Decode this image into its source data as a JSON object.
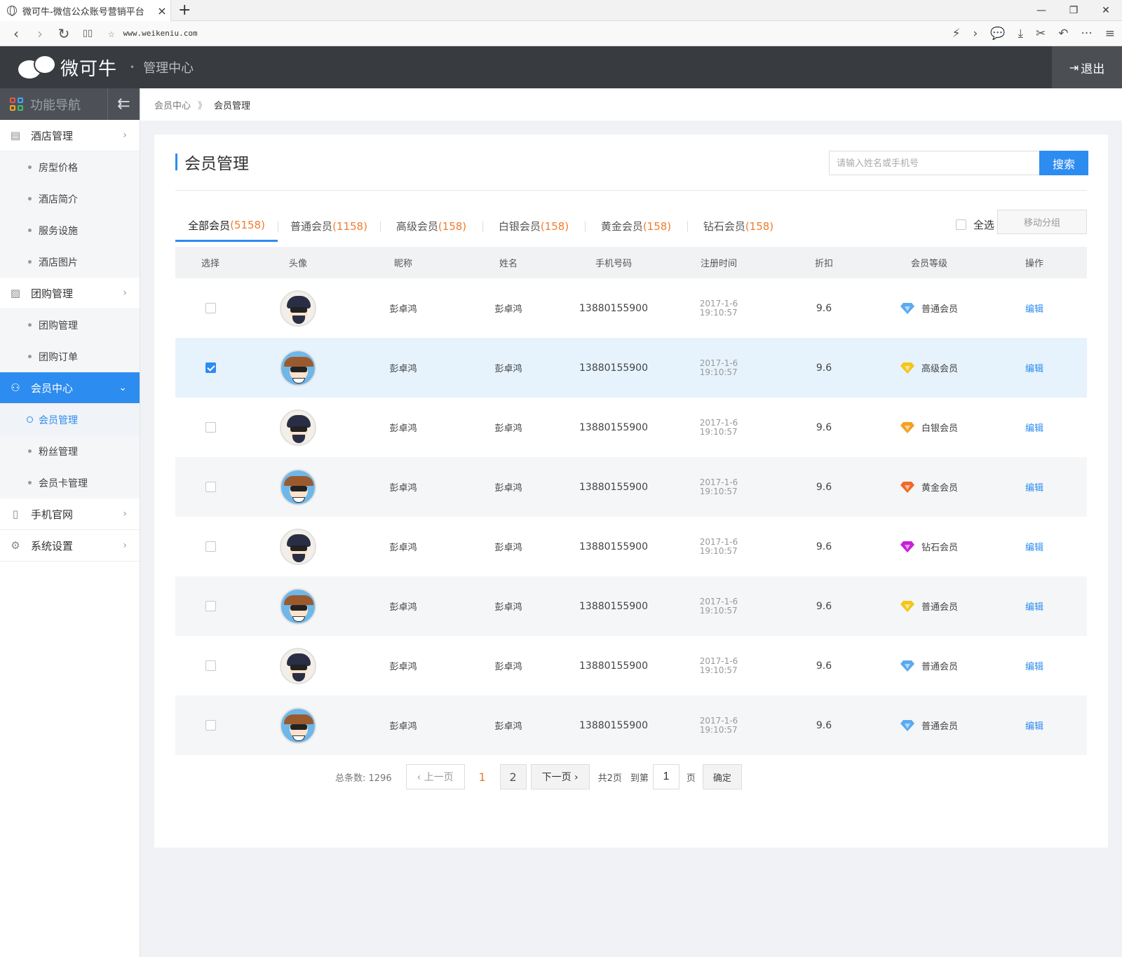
{
  "browser": {
    "tab_title": "微可牛-微信公众账号营销平台",
    "close": "×",
    "new_tab": "+",
    "url": "www.weikeniu.com",
    "win_min": "—",
    "win_max": "❐",
    "win_close": "✕",
    "nav_back": "‹",
    "nav_forward": "›",
    "nav_reload": "↻",
    "reader": "▯▯",
    "star": "☆",
    "tools": [
      "⚡",
      "›",
      "💬",
      "⤓",
      "✂",
      "↶",
      "···",
      "≡"
    ]
  },
  "header": {
    "brand": "微可牛",
    "dot": "•",
    "subtitle": "管理中心",
    "logout_icon": "⇥",
    "logout": "退出"
  },
  "sidebar": {
    "title": "功能导航",
    "collapse_icon": "⇇",
    "groups": [
      {
        "label": "酒店管理",
        "icon": "▤",
        "arrow": "›"
      },
      {
        "label": "团购管理",
        "icon": "▨",
        "arrow": "›"
      },
      {
        "label": "会员中心",
        "icon": "⚇",
        "arrow": "⌄"
      },
      {
        "label": "手机官网",
        "icon": "▯",
        "arrow": "›"
      },
      {
        "label": "系统设置",
        "icon": "⚙",
        "arrow": "›"
      }
    ],
    "hotel_items": [
      "房型价格",
      "酒店简介",
      "服务设施",
      "酒店图片"
    ],
    "group_items": [
      "团购管理",
      "团购订单"
    ],
    "member_items": [
      "会员管理",
      "粉丝管理",
      "会员卡管理"
    ]
  },
  "breadcrumb": {
    "parent": "会员中心",
    "sep": "》",
    "current": "会员管理"
  },
  "page": {
    "title": "会员管理",
    "search_placeholder": "请输入姓名或手机号",
    "search_button": "搜索",
    "select_all": "全选",
    "move_group": "移动分组"
  },
  "tabs": [
    {
      "label": "全部会员",
      "count": "(5158)"
    },
    {
      "label": "普通会员",
      "count": "(1158)"
    },
    {
      "label": "高级会员",
      "count": "(158)"
    },
    {
      "label": "白银会员",
      "count": "(158)"
    },
    {
      "label": "黄金会员",
      "count": "(158)"
    },
    {
      "label": "钻石会员",
      "count": "(158)"
    }
  ],
  "table": {
    "headers": [
      "选择",
      "头像",
      "昵称",
      "姓名",
      "手机号码",
      "注册时间",
      "折扣",
      "会员等级",
      "操作"
    ],
    "rows": [
      {
        "nickname": "彭卓鸿",
        "name": "彭卓鸿",
        "phone": "13880155900",
        "date": "2017-1-6",
        "time": "19:10:57",
        "discount": "9.6",
        "level": "普通会员",
        "level_color": "#5aaaf0",
        "action": "编辑"
      },
      {
        "nickname": "彭卓鸿",
        "name": "彭卓鸿",
        "phone": "13880155900",
        "date": "2017-1-6",
        "time": "19:10:57",
        "discount": "9.6",
        "level": "高级会员",
        "level_color": "#f5c518",
        "action": "编辑"
      },
      {
        "nickname": "彭卓鸿",
        "name": "彭卓鸿",
        "phone": "13880155900",
        "date": "2017-1-6",
        "time": "19:10:57",
        "discount": "9.6",
        "level": "白银会员",
        "level_color": "#f5a024",
        "action": "编辑"
      },
      {
        "nickname": "彭卓鸿",
        "name": "彭卓鸿",
        "phone": "13880155900",
        "date": "2017-1-6",
        "time": "19:10:57",
        "discount": "9.6",
        "level": "黄金会员",
        "level_color": "#f06a28",
        "action": "编辑"
      },
      {
        "nickname": "彭卓鸿",
        "name": "彭卓鸿",
        "phone": "13880155900",
        "date": "2017-1-6",
        "time": "19:10:57",
        "discount": "9.6",
        "level": "钻石会员",
        "level_color": "#c520d8",
        "action": "编辑"
      },
      {
        "nickname": "彭卓鸿",
        "name": "彭卓鸿",
        "phone": "13880155900",
        "date": "2017-1-6",
        "time": "19:10:57",
        "discount": "9.6",
        "level": "普通会员",
        "level_color": "#f5c518",
        "action": "编辑"
      },
      {
        "nickname": "彭卓鸿",
        "name": "彭卓鸿",
        "phone": "13880155900",
        "date": "2017-1-6",
        "time": "19:10:57",
        "discount": "9.6",
        "level": "普通会员",
        "level_color": "#5aaaf0",
        "action": "编辑"
      },
      {
        "nickname": "彭卓鸿",
        "name": "彭卓鸿",
        "phone": "13880155900",
        "date": "2017-1-6",
        "time": "19:10:57",
        "discount": "9.6",
        "level": "普通会员",
        "level_color": "#5aaaf0",
        "action": "编辑"
      }
    ]
  },
  "pagination": {
    "total": "总条数: 1296",
    "prev": "‹ 上一页",
    "page1": "1",
    "page2": "2",
    "next": "下一页 ›",
    "pages_info": "共2页",
    "goto_label": "到第",
    "goto_value": "1",
    "page_unit": "页",
    "confirm": "确定"
  }
}
